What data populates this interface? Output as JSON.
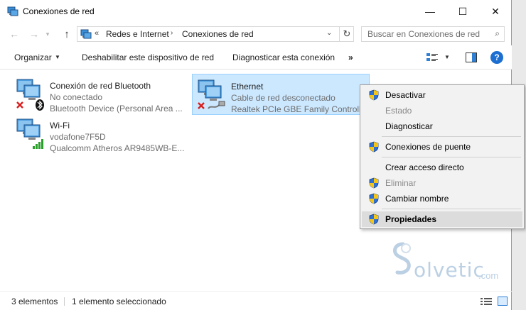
{
  "window": {
    "title": "Conexiones de red",
    "minimize_glyph": "—",
    "maximize_glyph": "☐",
    "close_glyph": "✕"
  },
  "address": {
    "overflow": "«",
    "crumbs": [
      "Redes e Internet",
      "Conexiones de red"
    ],
    "separator": "›",
    "search_placeholder": "Buscar en Conexiones de red"
  },
  "toolbar": {
    "organize": "Organizar",
    "disable": "Deshabilitar este dispositivo de red",
    "diagnose": "Diagnosticar esta conexión",
    "more": "»",
    "help": "?"
  },
  "connections": [
    {
      "name": "Conexión de red Bluetooth",
      "status": "No conectado",
      "device": "Bluetooth Device (Personal Area ...",
      "icon": "bluetooth-network-icon",
      "selected": false
    },
    {
      "name": "Ethernet",
      "status": "Cable de red desconectado",
      "device": "Realtek PCIe GBE Family Controller",
      "icon": "ethernet-network-icon",
      "selected": true
    },
    {
      "name": "Wi-Fi",
      "status": "vodafone7F5D",
      "device": "Qualcomm Atheros AR9485WB-E...",
      "icon": "wifi-network-icon",
      "selected": false
    }
  ],
  "context_menu": {
    "items": [
      {
        "label": "Desactivar",
        "shield": true,
        "disabled": false
      },
      {
        "label": "Estado",
        "shield": false,
        "disabled": true
      },
      {
        "label": "Diagnosticar",
        "shield": false,
        "disabled": false
      },
      {
        "label": "Conexiones de puente",
        "shield": true,
        "disabled": false
      },
      {
        "label": "Crear acceso directo",
        "shield": false,
        "disabled": false
      },
      {
        "label": "Eliminar",
        "shield": true,
        "disabled": true
      },
      {
        "label": "Cambiar nombre",
        "shield": true,
        "disabled": false
      },
      {
        "label": "Propiedades",
        "shield": true,
        "disabled": false,
        "highlighted": true
      }
    ]
  },
  "status": {
    "count": "3 elementos",
    "selection": "1 elemento seleccionado"
  },
  "watermark": {
    "text": "olvetic",
    "suffix": ".com"
  },
  "colors": {
    "selection_bg": "#cce8ff",
    "selection_border": "#99d1ff",
    "menu_bg": "#f2f2f2",
    "accent": "#1c6fd1"
  }
}
